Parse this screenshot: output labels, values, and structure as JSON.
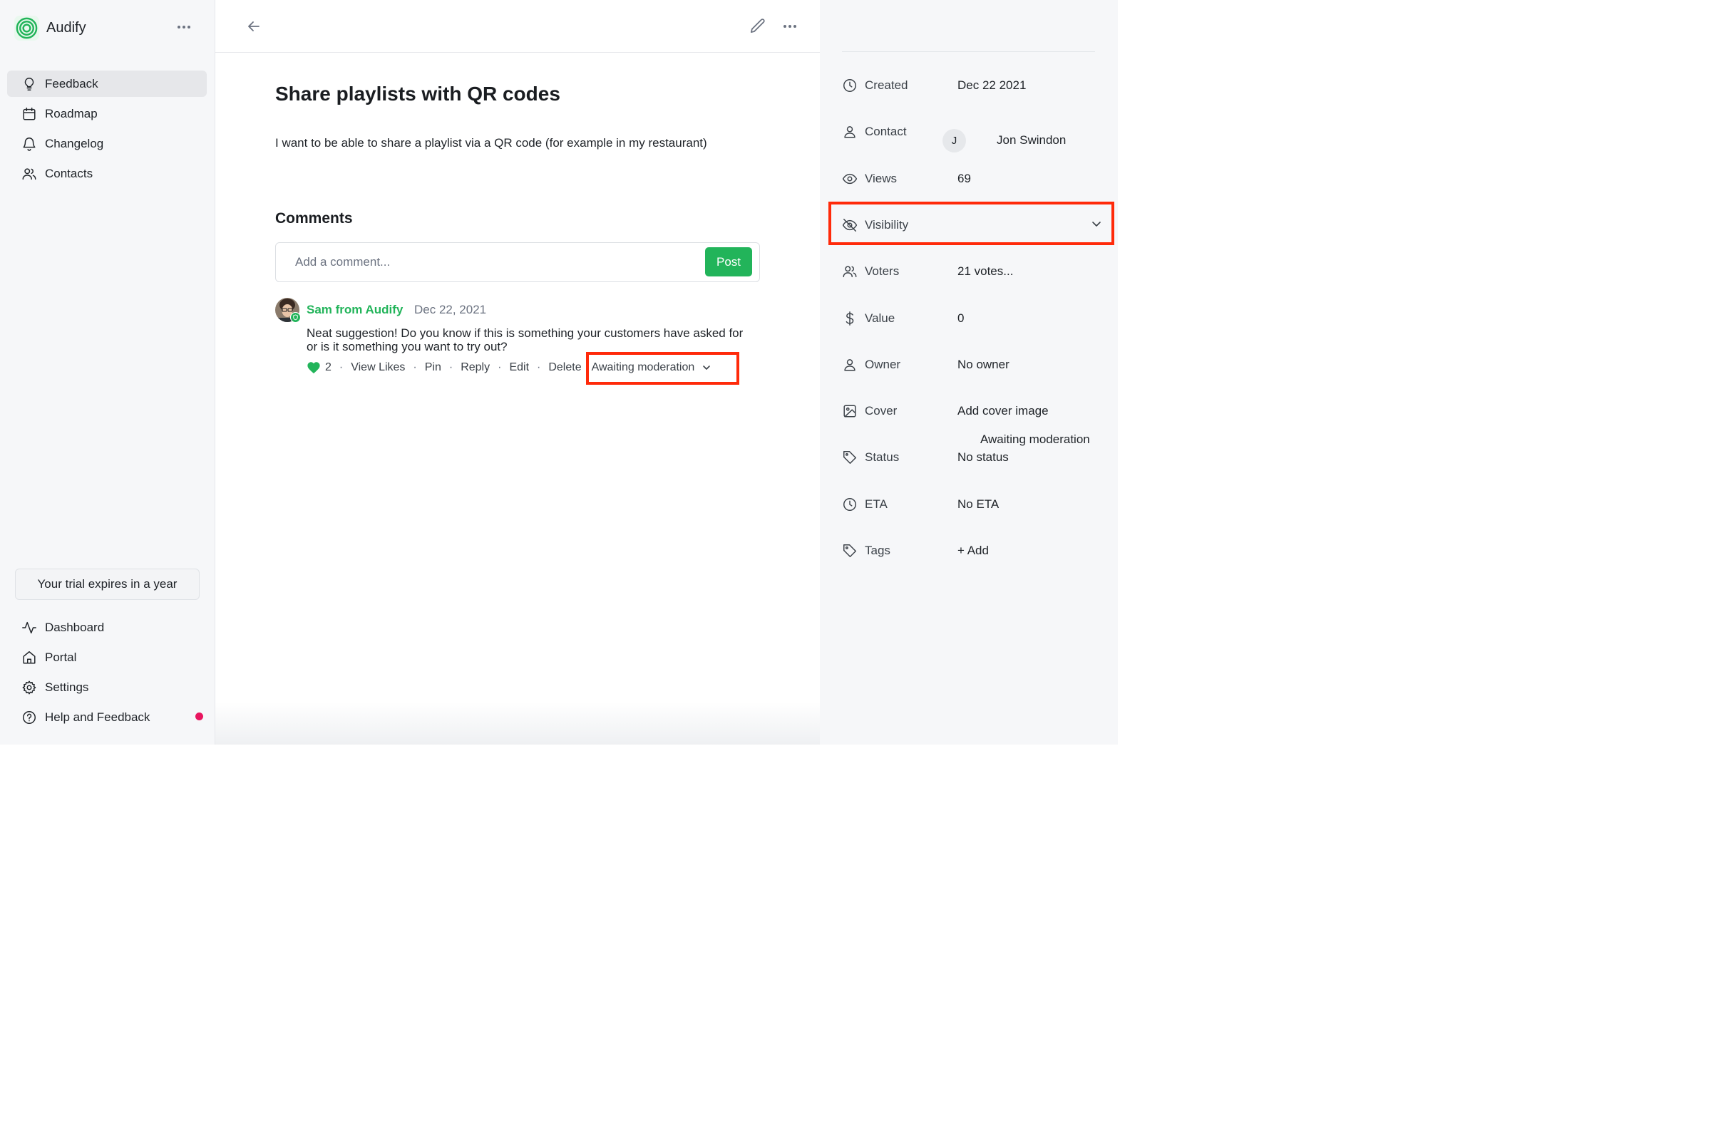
{
  "app": {
    "name": "Audify",
    "logo_icon": "audify-logo-icon",
    "accent_color": "#22b45a"
  },
  "sidebar": {
    "items": [
      {
        "label": "Feedback",
        "icon": "lightbulb-icon",
        "active": true
      },
      {
        "label": "Roadmap",
        "icon": "calendar-icon",
        "active": false
      },
      {
        "label": "Changelog",
        "icon": "bell-icon",
        "active": false
      },
      {
        "label": "Contacts",
        "icon": "users-icon",
        "active": false
      }
    ],
    "trial_text": "Your trial expires in a year",
    "bottom_items": [
      {
        "label": "Dashboard",
        "icon": "activity-icon"
      },
      {
        "label": "Portal",
        "icon": "home-icon"
      },
      {
        "label": "Settings",
        "icon": "gear-icon"
      },
      {
        "label": "Help and Feedback",
        "icon": "help-circle-icon"
      }
    ],
    "notification_color": "#e8155f"
  },
  "post": {
    "title": "Share playlists with QR codes",
    "body": "I want to be able to share a playlist via a QR code (for example in my restaurant)"
  },
  "comments": {
    "heading": "Comments",
    "input_placeholder": "Add a comment...",
    "post_label": "Post",
    "items": [
      {
        "author": "Sam from Audify",
        "date": "Dec 22, 2021",
        "text": "Neat suggestion! Do you know if this is something your customers have asked for or is it something you want to try out?",
        "likes": "2",
        "actions": {
          "view_likes": "View Likes",
          "pin": "Pin",
          "reply": "Reply",
          "edit": "Edit",
          "delete": "Delete"
        },
        "moderation": "Awaiting moderation"
      }
    ]
  },
  "properties": {
    "created": {
      "label": "Created",
      "value": "Dec 22 2021",
      "icon": "clock-icon"
    },
    "contact": {
      "label": "Contact",
      "initial": "J",
      "name": "Jon Swindon",
      "icon": "user-icon"
    },
    "views": {
      "label": "Views",
      "value": "69",
      "icon": "eye-icon"
    },
    "visibility": {
      "label": "Visibility",
      "value": "Awaiting moderation",
      "icon": "eye-off-icon"
    },
    "voters": {
      "label": "Voters",
      "value": "21 votes...",
      "icon": "users-icon"
    },
    "value": {
      "label": "Value",
      "value": "0",
      "icon": "dollar-icon"
    },
    "owner": {
      "label": "Owner",
      "value": "No owner",
      "icon": "user-icon"
    },
    "cover": {
      "label": "Cover",
      "value": "Add cover image",
      "icon": "image-icon"
    },
    "status": {
      "label": "Status",
      "value": "No status",
      "icon": "tag-icon"
    },
    "eta": {
      "label": "ETA",
      "value": "No ETA",
      "icon": "clock-icon"
    },
    "tags": {
      "label": "Tags",
      "value": "+ Add",
      "icon": "tag-icon"
    }
  },
  "highlight_color": "#ff2a0a"
}
